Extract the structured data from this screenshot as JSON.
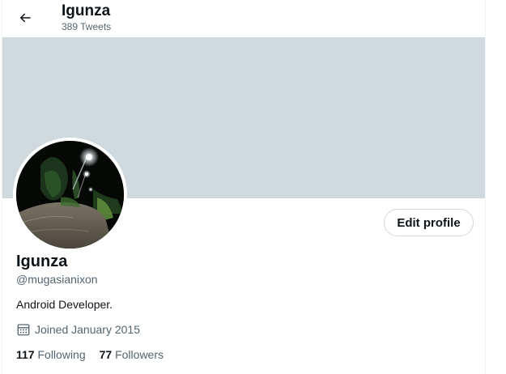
{
  "header": {
    "title": "Igunza",
    "tweet_count": "389 Tweets",
    "back_icon": "arrow-left-icon"
  },
  "banner": {
    "color": "#cfd9de"
  },
  "profile": {
    "avatar_icon": "profile-photo-avatar",
    "edit_label": "Edit profile",
    "name": "Igunza",
    "handle": "@mugasianixon",
    "bio": "Android Developer.",
    "joined": "Joined January 2015",
    "joined_icon": "calendar-icon"
  },
  "stats": {
    "following_count": "117",
    "following_label": "Following",
    "followers_count": "77",
    "followers_label": "Followers"
  },
  "colors": {
    "text_primary": "#0f1419",
    "text_secondary": "#536471",
    "border": "#cfd9de"
  }
}
